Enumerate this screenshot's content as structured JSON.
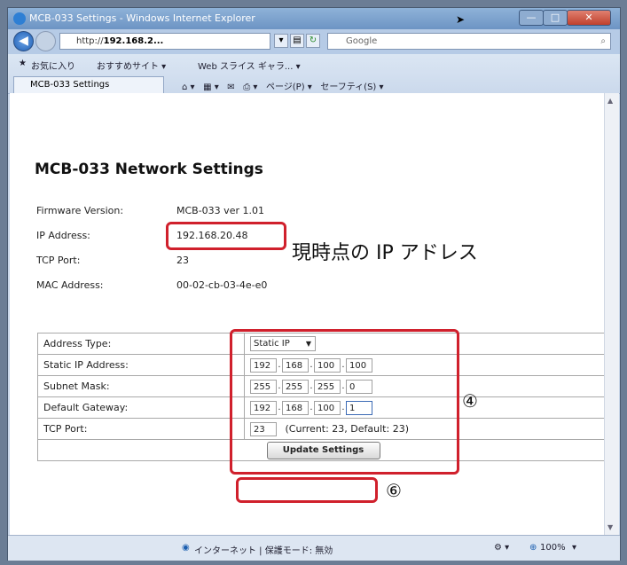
{
  "window": {
    "title": "MCB-033 Settings - Windows Internet Explorer",
    "min_glyph": "—",
    "max_glyph": "□",
    "close_glyph": "✕"
  },
  "nav": {
    "back_glyph": "◀",
    "address_prefix": "http://",
    "address_host": "192.168.2...",
    "search_placeholder": "Google",
    "search_glyph": "⌕"
  },
  "favorites": {
    "favorites_label": "お気に入り",
    "suggested_sites": "おすすめサイト ▾",
    "web_slice": "Web スライス ギャラ... ▾"
  },
  "tab": {
    "label": "MCB-033 Settings"
  },
  "toolbar": {
    "home": "⌂ ▾",
    "feeds": "▦ ▾",
    "mail": "✉",
    "print": "⎙ ▾",
    "page": "ページ(P) ▾",
    "safety": "セーフティ(S) ▾"
  },
  "page": {
    "heading": "MCB-033 Network Settings",
    "info": [
      {
        "label": "Firmware Version:",
        "value": "MCB-033 ver 1.01"
      },
      {
        "label": "IP Address:",
        "value": "192.168.20.48"
      },
      {
        "label": "TCP Port:",
        "value": "23"
      },
      {
        "label": "MAC Address:",
        "value": "00-02-cb-03-4e-e0"
      }
    ],
    "annotation_ip": "現時点の IP アドレス",
    "annotation_4": "④",
    "annotation_6": "⑥",
    "form": {
      "address_type_label": "Address Type:",
      "address_type_value": "Static IP",
      "static_ip_label": "Static IP Address:",
      "static_ip": [
        "192",
        "168",
        "100",
        "100"
      ],
      "subnet_label": "Subnet Mask:",
      "subnet": [
        "255",
        "255",
        "255",
        "0"
      ],
      "gateway_label": "Default Gateway:",
      "gateway": [
        "192",
        "168",
        "100",
        "1"
      ],
      "tcp_label": "TCP Port:",
      "tcp_value": "23",
      "tcp_note": "(Current: 23, Default: 23)",
      "update_button": "Update Settings"
    }
  },
  "status": {
    "zone": "インターネット | 保護モード: 無効",
    "zoom": "100%",
    "zoom_icon": "⊕",
    "zone_icon": "◉"
  }
}
